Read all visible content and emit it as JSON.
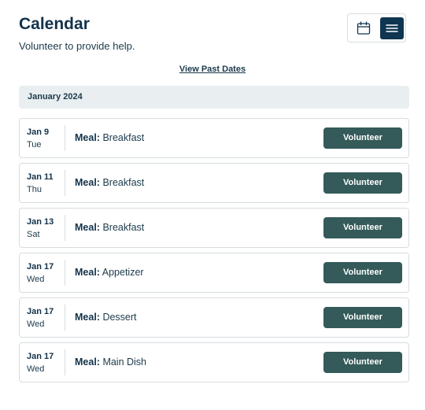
{
  "header": {
    "title": "Calendar",
    "subtitle": "Volunteer to provide help."
  },
  "view_toggle": {
    "calendar_icon": "calendar-icon",
    "list_icon": "list-icon",
    "active": "list"
  },
  "past_dates_link": "View Past Dates",
  "month": "January 2024",
  "meal_label": "Meal:",
  "volunteer_label": "Volunteer",
  "events": [
    {
      "date": "Jan 9",
      "day": "Tue",
      "meal": "Breakfast"
    },
    {
      "date": "Jan 11",
      "day": "Thu",
      "meal": "Breakfast"
    },
    {
      "date": "Jan 13",
      "day": "Sat",
      "meal": "Breakfast"
    },
    {
      "date": "Jan 17",
      "day": "Wed",
      "meal": "Appetizer"
    },
    {
      "date": "Jan 17",
      "day": "Wed",
      "meal": "Dessert"
    },
    {
      "date": "Jan 17",
      "day": "Wed",
      "meal": "Main Dish"
    }
  ],
  "colors": {
    "primary_dark": "#0f3550",
    "button": "#345a59",
    "month_bg": "#e9eef0",
    "border": "#d6dde0"
  }
}
